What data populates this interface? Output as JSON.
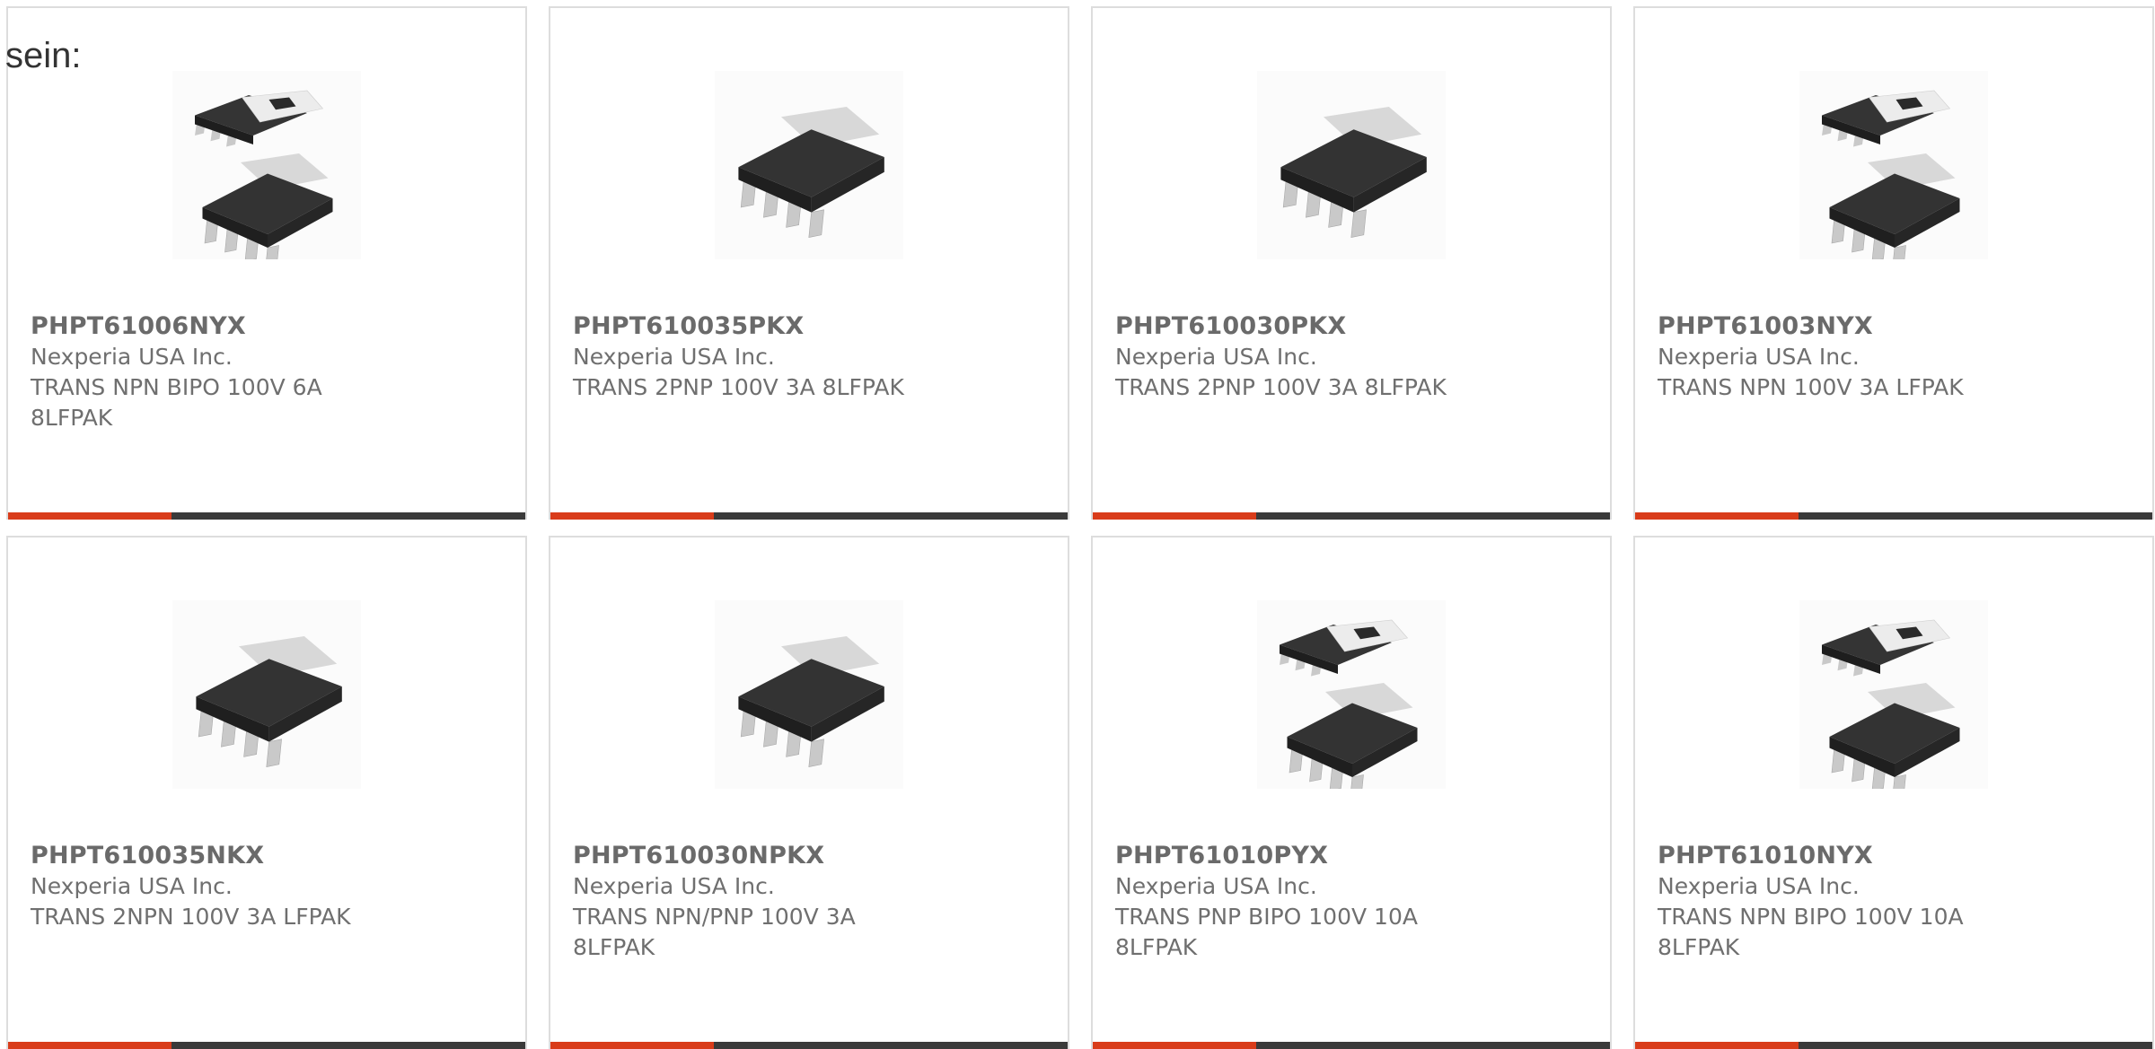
{
  "intro_text": "sein:",
  "accent_color": "#d93c1a",
  "products": [
    {
      "part": "PHPT61006NYX",
      "manufacturer": "Nexperia USA Inc.",
      "description": "TRANS NPN BIPO 100V 6A 8LFPAK",
      "image": "two-package-lfpak"
    },
    {
      "part": "PHPT610035PKX",
      "manufacturer": "Nexperia USA Inc.",
      "description": "TRANS 2PNP 100V 3A 8LFPAK",
      "image": "single-package-lfpak"
    },
    {
      "part": "PHPT610030PKX",
      "manufacturer": "Nexperia USA Inc.",
      "description": "TRANS 2PNP 100V 3A 8LFPAK",
      "image": "single-package-lfpak"
    },
    {
      "part": "PHPT61003NYX",
      "manufacturer": "Nexperia USA Inc.",
      "description": "TRANS NPN 100V 3A LFPAK",
      "image": "two-package-lfpak"
    },
    {
      "part": "PHPT610035NKX",
      "manufacturer": "Nexperia USA Inc.",
      "description": "TRANS 2NPN 100V 3A LFPAK",
      "image": "single-package-lfpak"
    },
    {
      "part": "PHPT610030NPKX",
      "manufacturer": "Nexperia USA Inc.",
      "description": "TRANS NPN/PNP 100V 3A 8LFPAK",
      "image": "single-package-lfpak"
    },
    {
      "part": "PHPT61010PYX",
      "manufacturer": "Nexperia USA Inc.",
      "description": "TRANS PNP BIPO 100V 10A 8LFPAK",
      "image": "two-package-lfpak"
    },
    {
      "part": "PHPT61010NYX",
      "manufacturer": "Nexperia USA Inc.",
      "description": "TRANS NPN BIPO 100V 10A 8LFPAK",
      "image": "two-package-lfpak"
    }
  ]
}
